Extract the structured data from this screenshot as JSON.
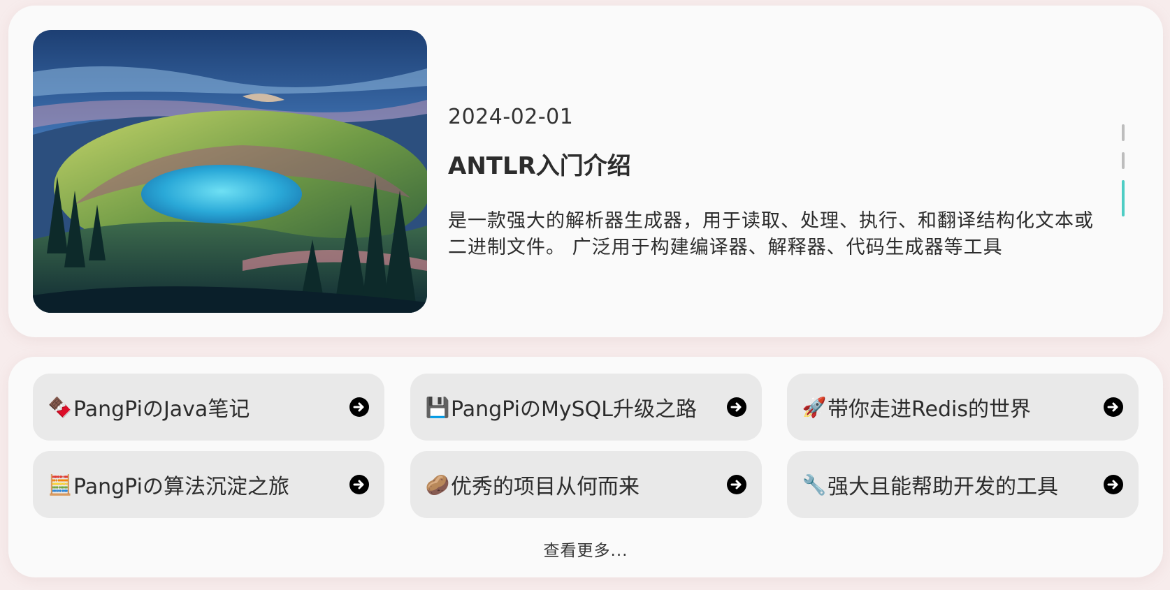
{
  "hero": {
    "date": "2024-02-01",
    "title": "ANTLR入门介绍",
    "description": "是一款强大的解析器生成器，用于读取、处理、执行、和翻译结构化文本或二进制文件。 广泛用于构建编译器、解释器、代码生成器等工具",
    "pager": {
      "count": 3,
      "active_index": 2
    }
  },
  "tiles": [
    {
      "emoji": "🍫",
      "icon": "chocolate-icon",
      "label": "PangPiのJava笔记"
    },
    {
      "emoji": "💾",
      "icon": "floppy-disk-icon",
      "label": "PangPiのMySQL升级之路"
    },
    {
      "emoji": "🚀",
      "icon": "rocket-icon",
      "label": "带你走进Redis的世界"
    },
    {
      "emoji": "🧮",
      "icon": "abacus-icon",
      "label": "PangPiの算法沉淀之旅"
    },
    {
      "emoji": "🥔",
      "icon": "potato-icon",
      "label": "优秀的项目从何而来"
    },
    {
      "emoji": "🔧",
      "icon": "wrench-icon",
      "label": "强大且能帮助开发的工具"
    }
  ],
  "more_label": "查看更多...",
  "colors": {
    "accent": "#4ecdc4",
    "background": "#f7ecec",
    "card": "#fafafa",
    "tile": "#e9e9e9"
  }
}
